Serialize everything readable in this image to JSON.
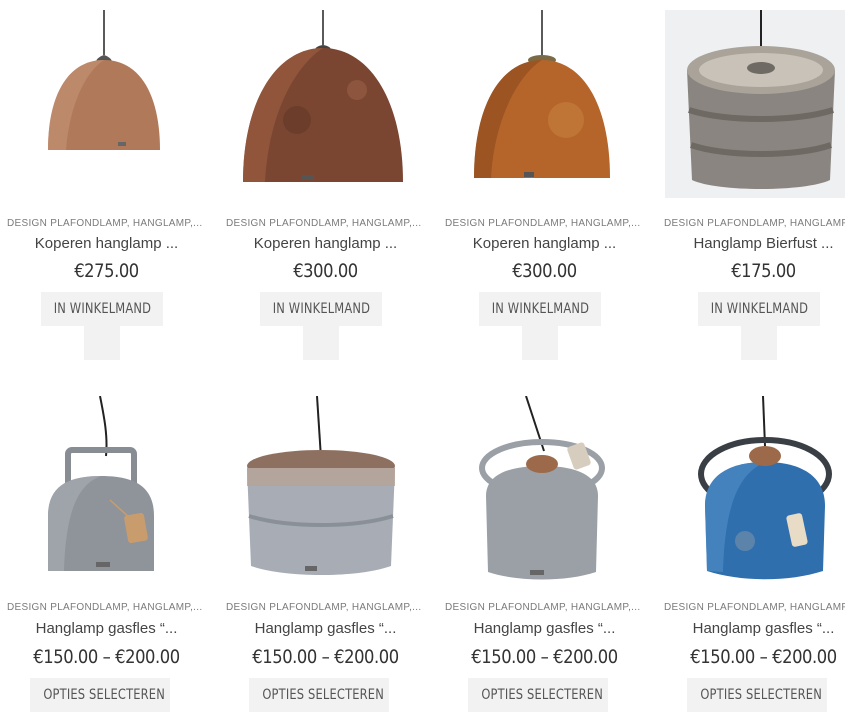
{
  "products": [
    {
      "category": "DESIGN PLAFONDLAMP, HANGLAMP,...",
      "title": "Koperen hanglamp ...",
      "price": "€275.00",
      "button": "IN WINKELMAND",
      "icon": "copper-dome-lamp-icon",
      "color": "#b07a5a"
    },
    {
      "category": "DESIGN PLAFONDLAMP, HANGLAMP,...",
      "title": "Koperen hanglamp ...",
      "price": "€300.00",
      "button": "IN WINKELMAND",
      "icon": "copper-dome-lamp-icon",
      "color": "#7a4632"
    },
    {
      "category": "DESIGN PLAFONDLAMP, HANGLAMP,...",
      "title": "Koperen hanglamp ...",
      "price": "€300.00",
      "button": "IN WINKELMAND",
      "icon": "copper-dome-lamp-icon",
      "color": "#b5652a"
    },
    {
      "category": "DESIGN PLAFONDLAMP, HANGLAMP,",
      "title": "Hanglamp Bierfust ...",
      "price": "€175.00",
      "button": "IN WINKELMAND",
      "icon": "beer-keg-lamp-icon",
      "color": "#8a8580"
    },
    {
      "category": "DESIGN PLAFONDLAMP, HANGLAMP,...",
      "title": "Hanglamp gasfles “...",
      "price": "€150.00 – €200.00",
      "button": "OPTIES SELECTEREN",
      "icon": "gas-bottle-lamp-icon",
      "color": "#8f949a"
    },
    {
      "category": "DESIGN PLAFONDLAMP, HANGLAMP,...",
      "title": "Hanglamp gasfles “...",
      "price": "€150.00 – €200.00",
      "button": "OPTIES SELECTEREN",
      "icon": "gas-bottle-lamp-icon",
      "color": "#a8adb5"
    },
    {
      "category": "DESIGN PLAFONDLAMP, HANGLAMP,...",
      "title": "Hanglamp gasfles “...",
      "price": "€150.00 – €200.00",
      "button": "OPTIES SELECTEREN",
      "icon": "gas-bottle-lamp-icon",
      "color": "#9aa0a6"
    },
    {
      "category": "DESIGN PLAFONDLAMP, HANGLAMP,",
      "title": "Hanglamp gasfles “...",
      "price": "€150.00 – €200.00",
      "button": "OPTIES SELECTEREN",
      "icon": "gas-bottle-lamp-icon",
      "color": "#2f6fae"
    }
  ]
}
